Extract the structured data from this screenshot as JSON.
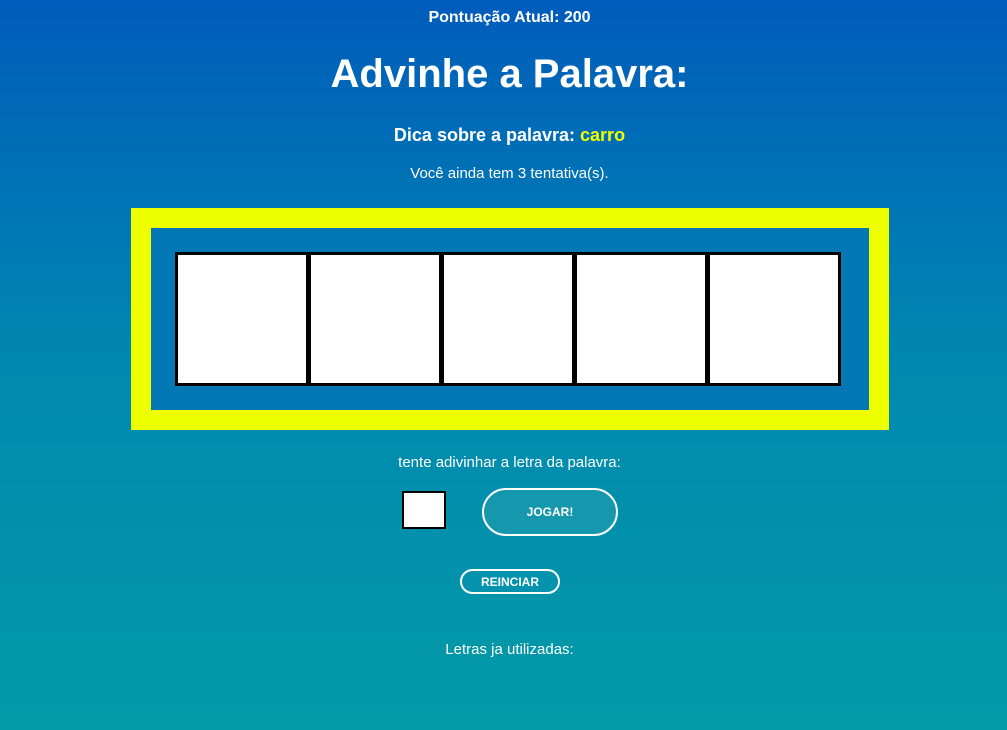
{
  "score": {
    "label": "Pontuação Atual:",
    "value": "200"
  },
  "title": "Advinhe a Palavra:",
  "hint": {
    "label": "Dica sobre a palavra:",
    "word": "carro",
    "word_color": "#f1ff00"
  },
  "attempts_text": "Você ainda tem 3 tentativa(s).",
  "word_slots": [
    "",
    "",
    "",
    "",
    ""
  ],
  "frame_color": "#eeff00",
  "guess": {
    "label": "tente adivinhar a letra da palavra:",
    "value": "",
    "play_label": "JOGAR!"
  },
  "reset_label": "REINCIAR",
  "used_letters": {
    "label": "Letras ja utilizadas:",
    "letters": ""
  }
}
